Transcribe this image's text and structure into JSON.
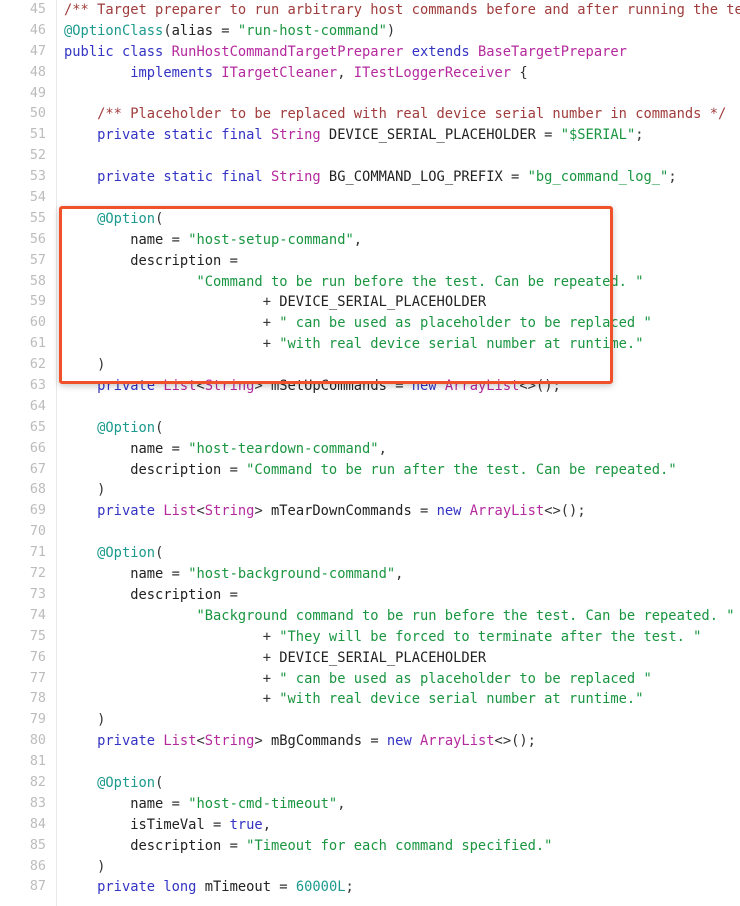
{
  "editor": {
    "language": "java",
    "background_color": "#ffffff",
    "gutter_color": "#bcbcbc",
    "first_line": 45,
    "last_line": 87
  },
  "colors": {
    "comment": "#a03c3c",
    "annotation": "#1c9a8e",
    "keyword": "#3333c4",
    "type": "#b5299e",
    "string": "#1a9641",
    "plain": "#222222",
    "number": "#1c9a8e",
    "highlight_border": "#f0502a"
  },
  "highlight": {
    "label": "annotation-highlight-box",
    "border_color": "#f0502a",
    "covers_lines": "55-62"
  },
  "lines": [
    {
      "n": "45",
      "tokens": [
        {
          "t": "comment",
          "s": "/** Target preparer to run arbitrary host commands before and after running the test. */"
        }
      ]
    },
    {
      "n": "46",
      "tokens": [
        {
          "t": "annot",
          "s": "@OptionClass"
        },
        {
          "t": "punct",
          "s": "("
        },
        {
          "t": "plain",
          "s": "alias "
        },
        {
          "t": "punct",
          "s": "= "
        },
        {
          "t": "string",
          "s": "\"run-host-command\""
        },
        {
          "t": "punct",
          "s": ")"
        }
      ]
    },
    {
      "n": "47",
      "tokens": [
        {
          "t": "keyword",
          "s": "public class "
        },
        {
          "t": "type",
          "s": "RunHostCommandTargetPreparer "
        },
        {
          "t": "keyword",
          "s": "extends "
        },
        {
          "t": "type",
          "s": "BaseTargetPreparer"
        }
      ]
    },
    {
      "n": "48",
      "tokens": [
        {
          "t": "plain",
          "s": "        "
        },
        {
          "t": "keyword",
          "s": "implements "
        },
        {
          "t": "type",
          "s": "ITargetCleaner"
        },
        {
          "t": "punct",
          "s": ", "
        },
        {
          "t": "type",
          "s": "ITestLoggerReceiver "
        },
        {
          "t": "punct",
          "s": "{"
        }
      ]
    },
    {
      "n": "49",
      "tokens": []
    },
    {
      "n": "50",
      "tokens": [
        {
          "t": "plain",
          "s": "    "
        },
        {
          "t": "comment",
          "s": "/** Placeholder to be replaced with real device serial number in commands */"
        }
      ]
    },
    {
      "n": "51",
      "tokens": [
        {
          "t": "plain",
          "s": "    "
        },
        {
          "t": "keyword",
          "s": "private static final "
        },
        {
          "t": "type",
          "s": "String "
        },
        {
          "t": "plain",
          "s": "DEVICE_SERIAL_PLACEHOLDER "
        },
        {
          "t": "punct",
          "s": "= "
        },
        {
          "t": "string",
          "s": "\"$SERIAL\""
        },
        {
          "t": "punct",
          "s": ";"
        }
      ]
    },
    {
      "n": "52",
      "tokens": []
    },
    {
      "n": "53",
      "tokens": [
        {
          "t": "plain",
          "s": "    "
        },
        {
          "t": "keyword",
          "s": "private static final "
        },
        {
          "t": "type",
          "s": "String "
        },
        {
          "t": "plain",
          "s": "BG_COMMAND_LOG_PREFIX "
        },
        {
          "t": "punct",
          "s": "= "
        },
        {
          "t": "string",
          "s": "\"bg_command_log_\""
        },
        {
          "t": "punct",
          "s": ";"
        }
      ]
    },
    {
      "n": "54",
      "tokens": []
    },
    {
      "n": "55",
      "tokens": [
        {
          "t": "plain",
          "s": "    "
        },
        {
          "t": "annot",
          "s": "@Option"
        },
        {
          "t": "punct",
          "s": "("
        }
      ]
    },
    {
      "n": "56",
      "tokens": [
        {
          "t": "plain",
          "s": "        name "
        },
        {
          "t": "punct",
          "s": "= "
        },
        {
          "t": "string",
          "s": "\"host-setup-command\""
        },
        {
          "t": "punct",
          "s": ","
        }
      ]
    },
    {
      "n": "57",
      "tokens": [
        {
          "t": "plain",
          "s": "        description "
        },
        {
          "t": "punct",
          "s": "="
        }
      ]
    },
    {
      "n": "58",
      "tokens": [
        {
          "t": "plain",
          "s": "                "
        },
        {
          "t": "string",
          "s": "\"Command to be run before the test. Can be repeated. \""
        }
      ]
    },
    {
      "n": "59",
      "tokens": [
        {
          "t": "plain",
          "s": "                        "
        },
        {
          "t": "punct",
          "s": "+ "
        },
        {
          "t": "plain",
          "s": "DEVICE_SERIAL_PLACEHOLDER"
        }
      ]
    },
    {
      "n": "60",
      "tokens": [
        {
          "t": "plain",
          "s": "                        "
        },
        {
          "t": "punct",
          "s": "+ "
        },
        {
          "t": "string",
          "s": "\" can be used as placeholder to be replaced \""
        }
      ]
    },
    {
      "n": "61",
      "tokens": [
        {
          "t": "plain",
          "s": "                        "
        },
        {
          "t": "punct",
          "s": "+ "
        },
        {
          "t": "string",
          "s": "\"with real device serial number at runtime.\""
        }
      ]
    },
    {
      "n": "62",
      "tokens": [
        {
          "t": "plain",
          "s": "    "
        },
        {
          "t": "punct",
          "s": ")"
        }
      ]
    },
    {
      "n": "63",
      "tokens": [
        {
          "t": "plain",
          "s": "    "
        },
        {
          "t": "keyword",
          "s": "private "
        },
        {
          "t": "type",
          "s": "List"
        },
        {
          "t": "punct",
          "s": "<"
        },
        {
          "t": "type",
          "s": "String"
        },
        {
          "t": "punct",
          "s": "> "
        },
        {
          "t": "plain",
          "s": "mSetUpCommands "
        },
        {
          "t": "punct",
          "s": "= "
        },
        {
          "t": "keyword",
          "s": "new "
        },
        {
          "t": "type",
          "s": "ArrayList"
        },
        {
          "t": "punct",
          "s": "<>();"
        }
      ]
    },
    {
      "n": "64",
      "tokens": []
    },
    {
      "n": "65",
      "tokens": [
        {
          "t": "plain",
          "s": "    "
        },
        {
          "t": "annot",
          "s": "@Option"
        },
        {
          "t": "punct",
          "s": "("
        }
      ]
    },
    {
      "n": "66",
      "tokens": [
        {
          "t": "plain",
          "s": "        name "
        },
        {
          "t": "punct",
          "s": "= "
        },
        {
          "t": "string",
          "s": "\"host-teardown-command\""
        },
        {
          "t": "punct",
          "s": ","
        }
      ]
    },
    {
      "n": "67",
      "tokens": [
        {
          "t": "plain",
          "s": "        description "
        },
        {
          "t": "punct",
          "s": "= "
        },
        {
          "t": "string",
          "s": "\"Command to be run after the test. Can be repeated.\""
        }
      ]
    },
    {
      "n": "68",
      "tokens": [
        {
          "t": "plain",
          "s": "    "
        },
        {
          "t": "punct",
          "s": ")"
        }
      ]
    },
    {
      "n": "69",
      "tokens": [
        {
          "t": "plain",
          "s": "    "
        },
        {
          "t": "keyword",
          "s": "private "
        },
        {
          "t": "type",
          "s": "List"
        },
        {
          "t": "punct",
          "s": "<"
        },
        {
          "t": "type",
          "s": "String"
        },
        {
          "t": "punct",
          "s": "> "
        },
        {
          "t": "plain",
          "s": "mTearDownCommands "
        },
        {
          "t": "punct",
          "s": "= "
        },
        {
          "t": "keyword",
          "s": "new "
        },
        {
          "t": "type",
          "s": "ArrayList"
        },
        {
          "t": "punct",
          "s": "<>();"
        }
      ]
    },
    {
      "n": "70",
      "tokens": []
    },
    {
      "n": "71",
      "tokens": [
        {
          "t": "plain",
          "s": "    "
        },
        {
          "t": "annot",
          "s": "@Option"
        },
        {
          "t": "punct",
          "s": "("
        }
      ]
    },
    {
      "n": "72",
      "tokens": [
        {
          "t": "plain",
          "s": "        name "
        },
        {
          "t": "punct",
          "s": "= "
        },
        {
          "t": "string",
          "s": "\"host-background-command\""
        },
        {
          "t": "punct",
          "s": ","
        }
      ]
    },
    {
      "n": "73",
      "tokens": [
        {
          "t": "plain",
          "s": "        description "
        },
        {
          "t": "punct",
          "s": "="
        }
      ]
    },
    {
      "n": "74",
      "tokens": [
        {
          "t": "plain",
          "s": "                "
        },
        {
          "t": "string",
          "s": "\"Background command to be run before the test. Can be repeated. \""
        }
      ]
    },
    {
      "n": "75",
      "tokens": [
        {
          "t": "plain",
          "s": "                        "
        },
        {
          "t": "punct",
          "s": "+ "
        },
        {
          "t": "string",
          "s": "\"They will be forced to terminate after the test. \""
        }
      ]
    },
    {
      "n": "76",
      "tokens": [
        {
          "t": "plain",
          "s": "                        "
        },
        {
          "t": "punct",
          "s": "+ "
        },
        {
          "t": "plain",
          "s": "DEVICE_SERIAL_PLACEHOLDER"
        }
      ]
    },
    {
      "n": "77",
      "tokens": [
        {
          "t": "plain",
          "s": "                        "
        },
        {
          "t": "punct",
          "s": "+ "
        },
        {
          "t": "string",
          "s": "\" can be used as placeholder to be replaced \""
        }
      ]
    },
    {
      "n": "78",
      "tokens": [
        {
          "t": "plain",
          "s": "                        "
        },
        {
          "t": "punct",
          "s": "+ "
        },
        {
          "t": "string",
          "s": "\"with real device serial number at runtime.\""
        }
      ]
    },
    {
      "n": "79",
      "tokens": [
        {
          "t": "plain",
          "s": "    "
        },
        {
          "t": "punct",
          "s": ")"
        }
      ]
    },
    {
      "n": "80",
      "tokens": [
        {
          "t": "plain",
          "s": "    "
        },
        {
          "t": "keyword",
          "s": "private "
        },
        {
          "t": "type",
          "s": "List"
        },
        {
          "t": "punct",
          "s": "<"
        },
        {
          "t": "type",
          "s": "String"
        },
        {
          "t": "punct",
          "s": "> "
        },
        {
          "t": "plain",
          "s": "mBgCommands "
        },
        {
          "t": "punct",
          "s": "= "
        },
        {
          "t": "keyword",
          "s": "new "
        },
        {
          "t": "type",
          "s": "ArrayList"
        },
        {
          "t": "punct",
          "s": "<>();"
        }
      ]
    },
    {
      "n": "81",
      "tokens": []
    },
    {
      "n": "82",
      "tokens": [
        {
          "t": "plain",
          "s": "    "
        },
        {
          "t": "annot",
          "s": "@Option"
        },
        {
          "t": "punct",
          "s": "("
        }
      ]
    },
    {
      "n": "83",
      "tokens": [
        {
          "t": "plain",
          "s": "        name "
        },
        {
          "t": "punct",
          "s": "= "
        },
        {
          "t": "string",
          "s": "\"host-cmd-timeout\""
        },
        {
          "t": "punct",
          "s": ","
        }
      ]
    },
    {
      "n": "84",
      "tokens": [
        {
          "t": "plain",
          "s": "        isTimeVal "
        },
        {
          "t": "punct",
          "s": "= "
        },
        {
          "t": "keyword",
          "s": "true"
        },
        {
          "t": "punct",
          "s": ","
        }
      ]
    },
    {
      "n": "85",
      "tokens": [
        {
          "t": "plain",
          "s": "        description "
        },
        {
          "t": "punct",
          "s": "= "
        },
        {
          "t": "string",
          "s": "\"Timeout for each command specified.\""
        }
      ]
    },
    {
      "n": "86",
      "tokens": [
        {
          "t": "plain",
          "s": "    "
        },
        {
          "t": "punct",
          "s": ")"
        }
      ]
    },
    {
      "n": "87",
      "tokens": [
        {
          "t": "plain",
          "s": "    "
        },
        {
          "t": "keyword",
          "s": "private long "
        },
        {
          "t": "plain",
          "s": "mTimeout "
        },
        {
          "t": "punct",
          "s": "= "
        },
        {
          "t": "number",
          "s": "60000L"
        },
        {
          "t": "punct",
          "s": ";"
        }
      ]
    }
  ]
}
